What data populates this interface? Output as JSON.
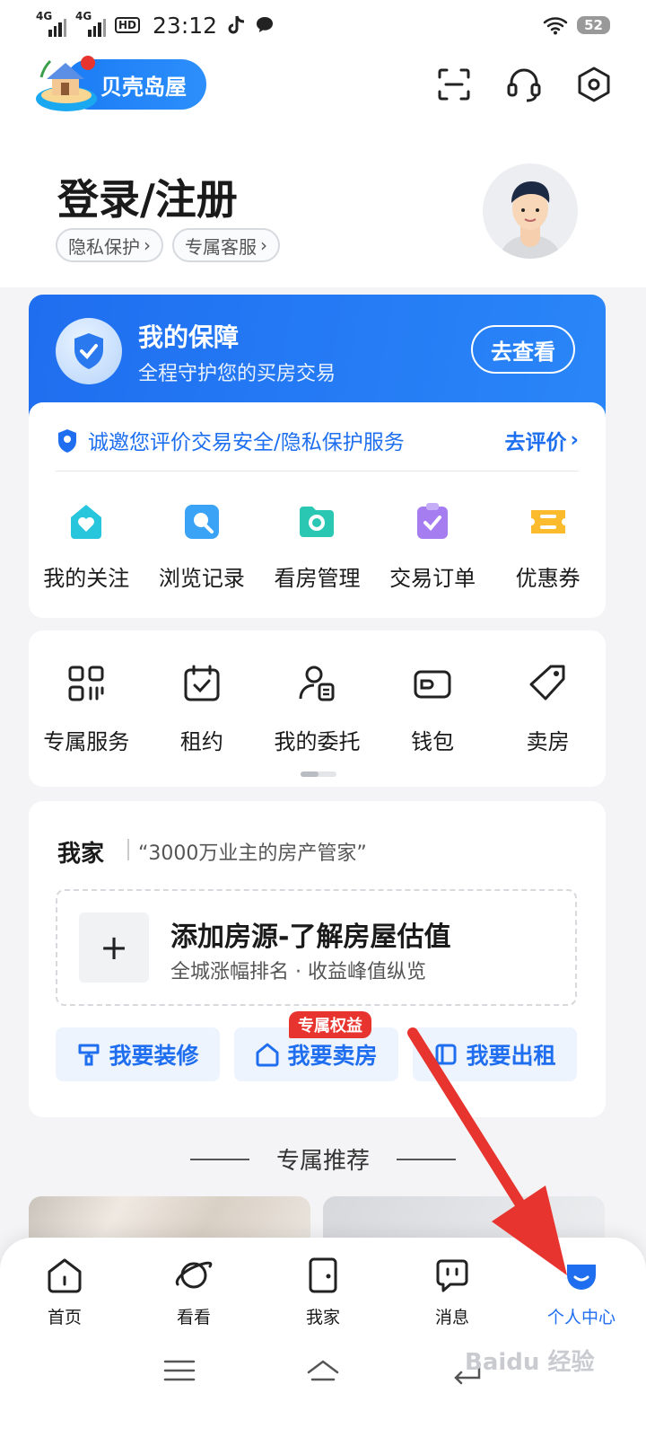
{
  "status_bar": {
    "net1": "4G",
    "net2": "4G",
    "hd": "HD",
    "time": "23:12",
    "battery": "52"
  },
  "header": {
    "app_name": "贝壳岛屋",
    "icons": [
      "scan-icon",
      "headset-icon",
      "settings-icon"
    ]
  },
  "profile": {
    "login_title": "登录/注册",
    "chips": [
      "隐私保护",
      "专属客服"
    ]
  },
  "protection": {
    "title": "我的保障",
    "subtitle": "全程守护您的买房交易",
    "button": "去查看",
    "invite_text": "诚邀您评价交易安全/隐私保护服务",
    "invite_action": "去评价"
  },
  "quick_actions": [
    {
      "label": "我的关注",
      "icon": "heart-icon",
      "color": "#27c6dd"
    },
    {
      "label": "浏览记录",
      "icon": "search-icon",
      "color": "#3ba3f5"
    },
    {
      "label": "看房管理",
      "icon": "folder-icon",
      "color": "#2ac7b3"
    },
    {
      "label": "交易订单",
      "icon": "clipboard-icon",
      "color": "#a57df1"
    },
    {
      "label": "优惠券",
      "icon": "coupon-icon",
      "color": "#fbbb2d"
    }
  ],
  "services": [
    {
      "label": "专属服务",
      "icon": "grid-icon"
    },
    {
      "label": "租约",
      "icon": "calendar-check-icon"
    },
    {
      "label": "我的委托",
      "icon": "person-doc-icon"
    },
    {
      "label": "钱包",
      "icon": "wallet-icon"
    },
    {
      "label": "卖房",
      "icon": "tag-icon"
    }
  ],
  "my_home": {
    "title": "我家",
    "subtitle": "“3000万业主的房产管家”",
    "add_plus": "+",
    "add_title": "添加房源-了解房屋估值",
    "add_subtitle": "全城涨幅排名 · 收益峰值纵览",
    "actions": [
      "我要装修",
      "我要卖房",
      "我要出租"
    ],
    "benefit_tag": "专属权益"
  },
  "recommend": {
    "title": "专属推荐"
  },
  "bottom_nav": [
    {
      "label": "首页",
      "icon": "home-icon",
      "active": false
    },
    {
      "label": "看看",
      "icon": "planet-icon",
      "active": false
    },
    {
      "label": "我家",
      "icon": "door-icon",
      "active": false
    },
    {
      "label": "消息",
      "icon": "message-icon",
      "active": false
    },
    {
      "label": "个人中心",
      "icon": "profile-icon",
      "active": true
    }
  ],
  "watermark": "Baidu 经验",
  "colors": {
    "brand_blue": "#1f6ef0",
    "annotation_red": "#e8342e"
  }
}
